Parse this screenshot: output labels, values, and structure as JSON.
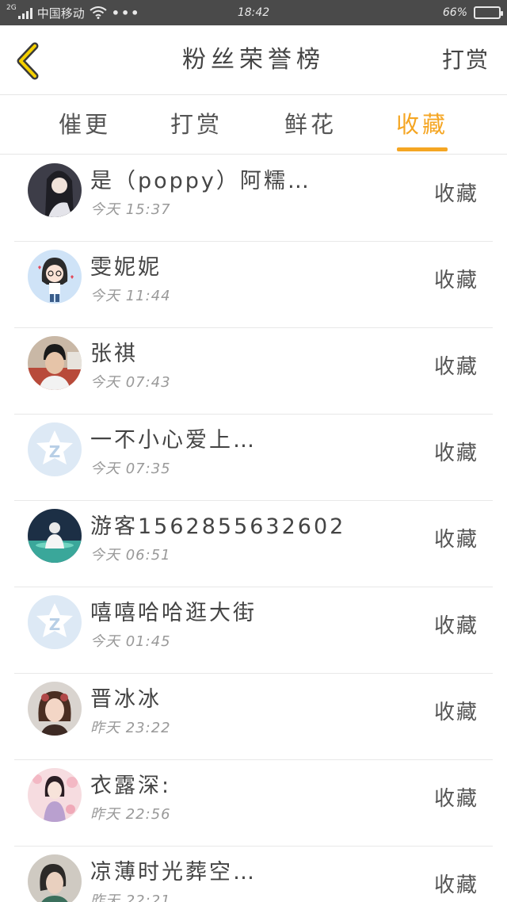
{
  "status_bar": {
    "network_tag": "2G",
    "carrier": "中国移动",
    "time": "18:42",
    "battery": "66%",
    "battery_level": 0.66
  },
  "header": {
    "title": "粉丝荣誉榜",
    "right_link": "打赏",
    "back_icon": "chevron-left-icon",
    "accent_color": "#f5a623"
  },
  "tabs": [
    {
      "label": "催更",
      "active": false
    },
    {
      "label": "打赏",
      "active": false
    },
    {
      "label": "鲜花",
      "active": false
    },
    {
      "label": "收藏",
      "active": true
    }
  ],
  "fans": [
    {
      "name": "是（poppy）阿糯…",
      "time": "今天 15:37",
      "action": "收藏",
      "avatar": "photo"
    },
    {
      "name": "雯妮妮",
      "time": "今天 11:44",
      "action": "收藏",
      "avatar": "cartoon"
    },
    {
      "name": "张祺",
      "time": "今天 07:43",
      "action": "收藏",
      "avatar": "photo"
    },
    {
      "name": "一不小心爱上…",
      "time": "今天 07:35",
      "action": "收藏",
      "avatar": "default-qq"
    },
    {
      "name": "游客1562855632602",
      "time": "今天 06:51",
      "action": "收藏",
      "avatar": "photo"
    },
    {
      "name": "嘻嘻哈哈逛大街",
      "time": "今天 01:45",
      "action": "收藏",
      "avatar": "default-qq"
    },
    {
      "name": "晋冰冰",
      "time": "昨天 23:22",
      "action": "收藏",
      "avatar": "photo"
    },
    {
      "name": "衣露深:",
      "time": "昨天 22:56",
      "action": "收藏",
      "avatar": "illustration"
    },
    {
      "name": "凉薄时光葬空…",
      "time": "昨天 22:21",
      "action": "收藏",
      "avatar": "photo"
    }
  ]
}
